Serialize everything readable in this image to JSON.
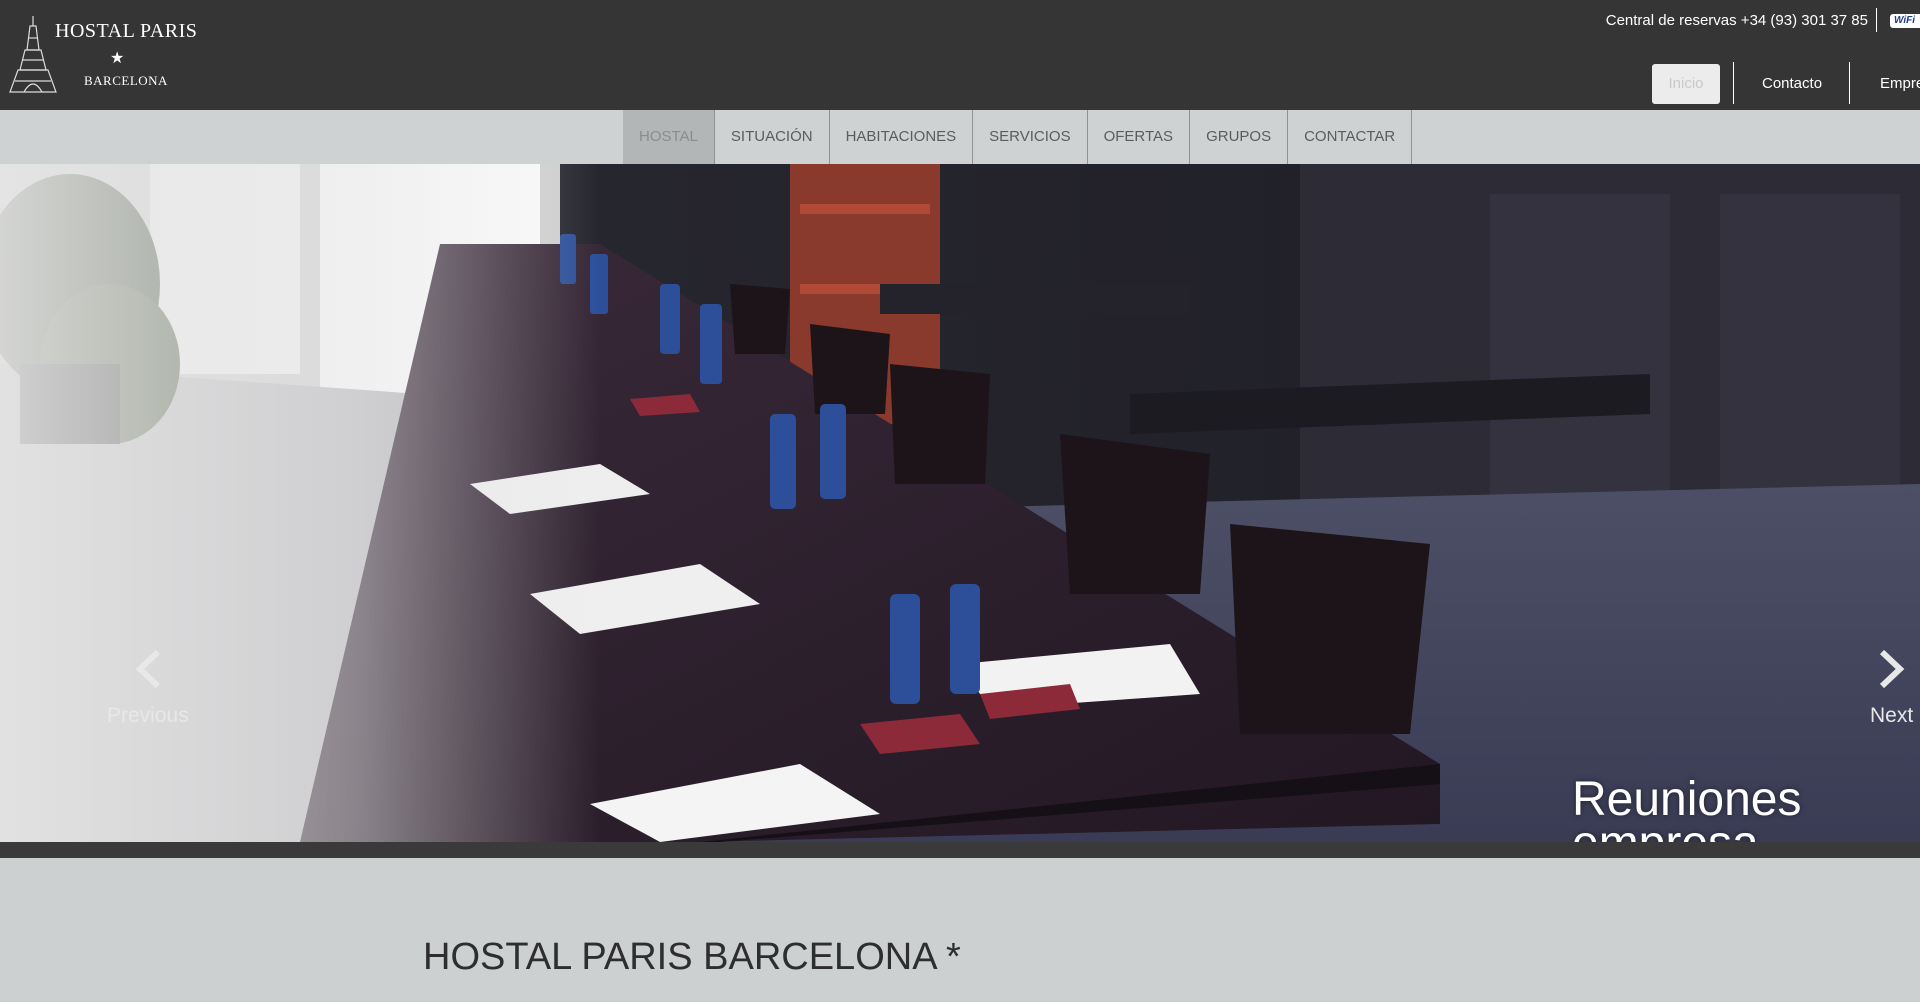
{
  "header": {
    "logo": {
      "name": "HOSTAL PARIS",
      "star": "★",
      "city": "BARCELONA"
    },
    "phone_text": "Central de reservas +34 (93) 301 37 85",
    "wifi_badge": "WiFi",
    "top_links": [
      "Inicio",
      "Contacto",
      "Empre"
    ]
  },
  "nav": {
    "items": [
      "HOSTAL",
      "SITUACIÓN",
      "HABITACIONES",
      "SERVICIOS",
      "OFERTAS",
      "GRUPOS",
      "CONTACTAR"
    ],
    "active_index": 0
  },
  "hero": {
    "prev_label": "Previous",
    "next_label": "Next",
    "caption": "Reuniones empresa, grupos, escuelas..."
  },
  "content": {
    "title": "HOSTAL PARIS BARCELONA *"
  },
  "colors": {
    "header_bg": "#353535",
    "nav_bg": "#cfd2d2",
    "nav_active_bg": "#b3b6b6",
    "page_bg": "#ccd0d0",
    "hero_strip": "#3a3a3a"
  }
}
